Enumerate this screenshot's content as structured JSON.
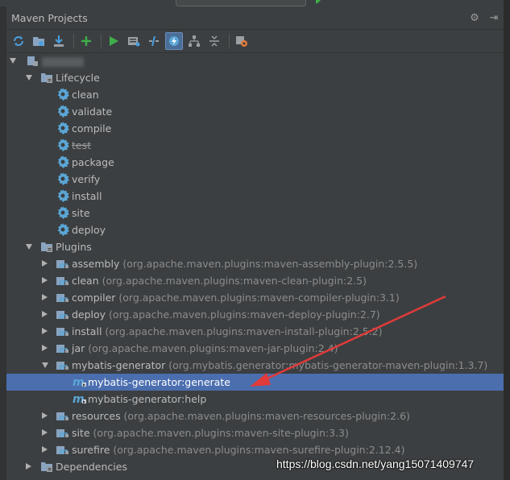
{
  "panel": {
    "title": "Maven Projects"
  },
  "toolbar": {
    "icons": [
      "reimport-icon",
      "generate-sources-icon",
      "download-icon",
      "add-icon",
      "run-icon",
      "execute-goal-icon",
      "toggle-offline-icon",
      "skip-tests-icon",
      "show-dependencies-icon",
      "collapse-all-icon",
      "settings-icon"
    ]
  },
  "tree": {
    "lifecycle": {
      "label": "Lifecycle",
      "goals": [
        "clean",
        "validate",
        "compile",
        "test",
        "package",
        "verify",
        "install",
        "site",
        "deploy"
      ]
    },
    "plugins": {
      "label": "Plugins",
      "items": [
        {
          "name": "assembly",
          "coords": "(org.apache.maven.plugins:maven-assembly-plugin:2.5.5)"
        },
        {
          "name": "clean",
          "coords": "(org.apache.maven.plugins:maven-clean-plugin:2.5)"
        },
        {
          "name": "compiler",
          "coords": "(org.apache.maven.plugins:maven-compiler-plugin:3.1)"
        },
        {
          "name": "deploy",
          "coords": "(org.apache.maven.plugins:maven-deploy-plugin:2.7)"
        },
        {
          "name": "install",
          "coords": "(org.apache.maven.plugins:maven-install-plugin:2.5.2)"
        },
        {
          "name": "jar",
          "coords": "(org.apache.maven.plugins:maven-jar-plugin:2.4)"
        },
        {
          "name": "mybatis-generator",
          "coords": "(org.mybatis.generator:mybatis-generator-maven-plugin:1.3.7)"
        },
        {
          "name": "resources",
          "coords": "(org.apache.maven.plugins:maven-resources-plugin:2.6)"
        },
        {
          "name": "site",
          "coords": "(org.apache.maven.plugins:maven-site-plugin:3.3)"
        },
        {
          "name": "surefire",
          "coords": "(org.apache.maven.plugins:maven-surefire-plugin:2.12.4)"
        }
      ],
      "mybatis_goals": [
        "mybatis-generator:generate",
        "mybatis-generator:help"
      ]
    },
    "dependencies": {
      "label": "Dependencies"
    }
  },
  "watermark": "https://blog.csdn.net/yang15071409747",
  "colors": {
    "background": "#3c3f41",
    "selection": "#4b6eaf",
    "gear": "#5aa6d6",
    "run": "#3fae4a",
    "annotation_arrow": "#e03a3a"
  }
}
